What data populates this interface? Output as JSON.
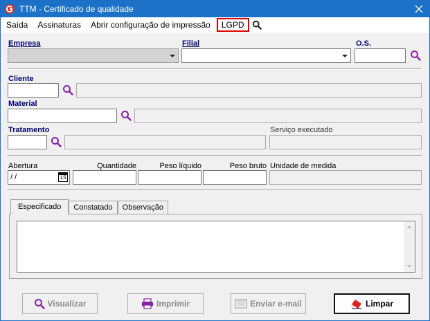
{
  "window": {
    "title": "TTM - Certificado de qualidade"
  },
  "menu": {
    "items": [
      "Saída",
      "Assinaturas",
      "Abrir configuração de impressão",
      "LGPD"
    ]
  },
  "form": {
    "empresa_label": "Empresa",
    "filial_label": "Filial",
    "os_label": "O.S.",
    "cliente_label": "Cliente",
    "material_label": "Material",
    "tratamento_label": "Tratamento",
    "servico_label": "Serviço executado",
    "abertura_label": "Abertura",
    "abertura_value": " / /",
    "quantidade_label": "Quantidade",
    "peso_liquido_label": "Peso líquido",
    "peso_bruto_label": "Peso bruto",
    "unidade_label": "Unidade de medida",
    "calendar_glyph": "15"
  },
  "tabs": [
    {
      "label": "Especificado"
    },
    {
      "label": "Constatado"
    },
    {
      "label": "Observação"
    }
  ],
  "buttons": {
    "visualizar": "Visualizar",
    "imprimir": "Imprimir",
    "enviar": "Enviar e-mail",
    "limpar": "Limpar"
  },
  "colors": {
    "titlebar": "#1c71c8",
    "label_bold": "#00006e",
    "search_icon": "#8b1fa8",
    "highlight": "#e00000"
  }
}
